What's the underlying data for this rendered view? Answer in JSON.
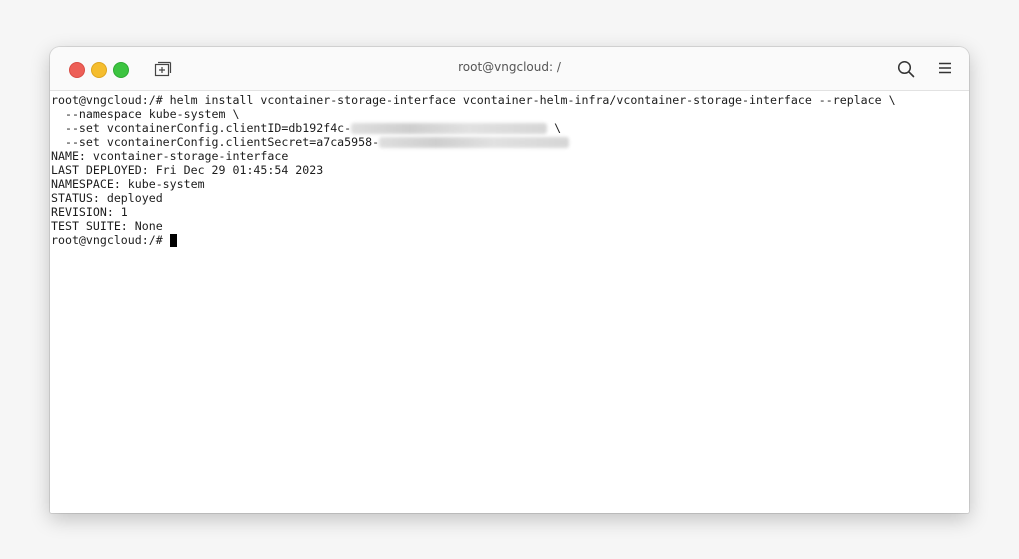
{
  "window": {
    "title": "root@vngcloud: /"
  },
  "terminal": {
    "lines": [
      {
        "text": "root@vngcloud:/# helm install vcontainer-storage-interface vcontainer-helm-infra/vcontainer-storage-interface --replace \\"
      },
      {
        "text": "  --namespace kube-system \\"
      },
      {
        "prefix": "  --set vcontainerConfig.clientID=db192f4c-",
        "suffix": " \\"
      },
      {
        "prefix": "  --set vcontainerConfig.clientSecret=a7ca5958-",
        "suffix": ""
      },
      {
        "text": "NAME: vcontainer-storage-interface"
      },
      {
        "text": "LAST DEPLOYED: Fri Dec 29 01:45:54 2023"
      },
      {
        "text": "NAMESPACE: kube-system"
      },
      {
        "text": "STATUS: deployed"
      },
      {
        "text": "REVISION: 1"
      },
      {
        "text": "TEST SUITE: None"
      },
      {
        "text": "root@vngcloud:/# "
      }
    ]
  },
  "icons": {
    "close": "close-window-icon",
    "minimize": "minimize-window-icon",
    "maximize": "maximize-window-icon",
    "new_tab": "new-tab-icon",
    "search": "search-icon",
    "menu": "hamburger-menu-icon"
  },
  "colors": {
    "close": "#ed5f57",
    "minimize": "#f5bd2e",
    "maximize": "#3cc440"
  }
}
